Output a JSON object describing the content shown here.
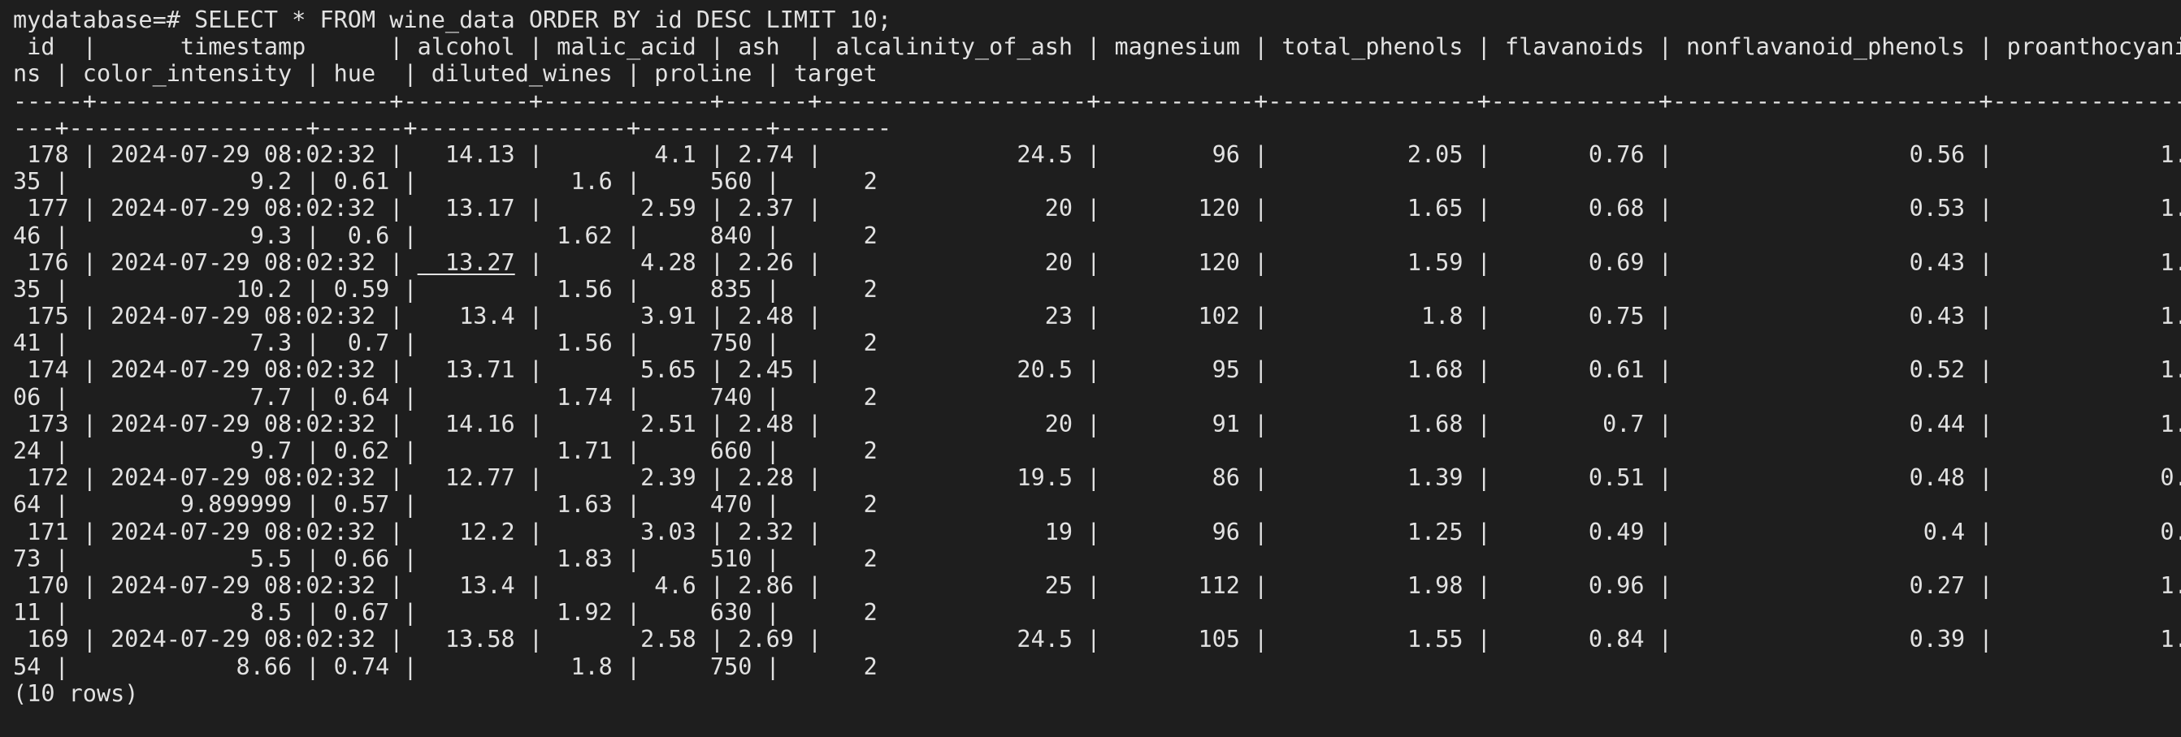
{
  "terminal": {
    "prompt": "mydatabase=# ",
    "command": "SELECT * FROM wine_data ORDER BY id DESC LIMIT 10;",
    "header_lines": [
      " id  |      timestamp      | alcohol | malic_acid | ash  | alcalinity_of_ash | magnesium | total_phenols | flavanoids | nonflavanoid_phenols | proanthocyani",
      "ns | color_intensity | hue  | diluted_wines | proline | target",
      "-----+---------------------+---------+------------+------+-------------------+-----------+---------------+------------+----------------------+--------------",
      "---+-----------------+------+---------------+---------+--------"
    ],
    "rows": [
      {
        "id_ts": " 178 | 2024-07-29 08:02:32 | ",
        "alcohol": "  14.13",
        "rest": " |        4.1 | 2.74 |              24.5 |        96 |          2.05 |       0.76 |                 0.56 |            1.",
        "wrap": "35 |             9.2 | 0.61 |           1.6 |     560 |      2"
      },
      {
        "id_ts": " 177 | 2024-07-29 08:02:32 | ",
        "alcohol": "  13.17",
        "rest": " |       2.59 | 2.37 |                20 |       120 |          1.65 |       0.68 |                 0.53 |            1.",
        "wrap": "46 |             9.3 |  0.6 |          1.62 |     840 |      2"
      },
      {
        "id_ts": " 176 | 2024-07-29 08:02:32 | ",
        "alcohol": "  13.27",
        "rest": " |       4.28 | 2.26 |                20 |       120 |          1.59 |       0.69 |                 0.43 |            1.",
        "wrap": "35 |            10.2 | 0.59 |          1.56 |     835 |      2"
      },
      {
        "id_ts": " 175 | 2024-07-29 08:02:32 | ",
        "alcohol": "   13.4",
        "rest": " |       3.91 | 2.48 |                23 |       102 |           1.8 |       0.75 |                 0.43 |            1.",
        "wrap": "41 |             7.3 |  0.7 |          1.56 |     750 |      2"
      },
      {
        "id_ts": " 174 | 2024-07-29 08:02:32 | ",
        "alcohol": "  13.71",
        "rest": " |       5.65 | 2.45 |              20.5 |        95 |          1.68 |       0.61 |                 0.52 |            1.",
        "wrap": "06 |             7.7 | 0.64 |          1.74 |     740 |      2"
      },
      {
        "id_ts": " 173 | 2024-07-29 08:02:32 | ",
        "alcohol": "  14.16",
        "rest": " |       2.51 | 2.48 |                20 |        91 |          1.68 |        0.7 |                 0.44 |            1.",
        "wrap": "24 |             9.7 | 0.62 |          1.71 |     660 |      2"
      },
      {
        "id_ts": " 172 | 2024-07-29 08:02:32 | ",
        "alcohol": "  12.77",
        "rest": " |       2.39 | 2.28 |              19.5 |        86 |          1.39 |       0.51 |                 0.48 |            0.",
        "wrap": "64 |        9.899999 | 0.57 |          1.63 |     470 |      2"
      },
      {
        "id_ts": " 171 | 2024-07-29 08:02:32 | ",
        "alcohol": "   12.2",
        "rest": " |       3.03 | 2.32 |                19 |        96 |          1.25 |       0.49 |                  0.4 |            0.",
        "wrap": "73 |             5.5 | 0.66 |          1.83 |     510 |      2"
      },
      {
        "id_ts": " 170 | 2024-07-29 08:02:32 | ",
        "alcohol": "   13.4",
        "rest": " |        4.6 | 2.86 |                25 |       112 |          1.98 |       0.96 |                 0.27 |            1.",
        "wrap": "11 |             8.5 | 0.67 |          1.92 |     630 |      2"
      },
      {
        "id_ts": " 169 | 2024-07-29 08:02:32 | ",
        "alcohol": "  13.58",
        "rest": " |       2.58 | 2.69 |              24.5 |       105 |          1.55 |       0.84 |                 0.39 |            1.",
        "wrap": "54 |            8.66 | 0.74 |           1.8 |     750 |      2"
      }
    ],
    "footer": "(10 rows)"
  }
}
